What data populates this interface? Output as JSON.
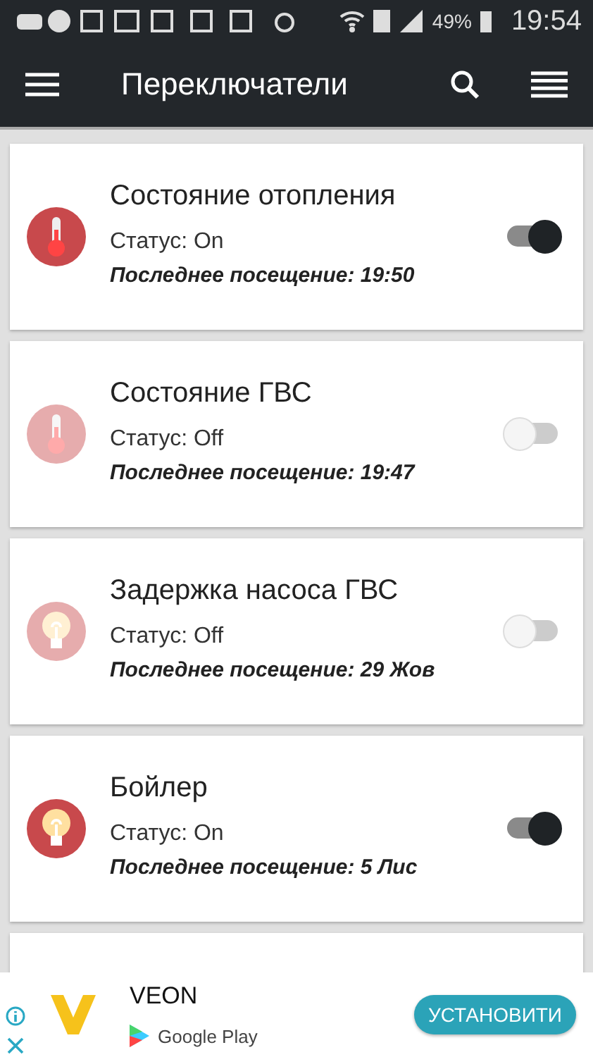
{
  "status_bar": {
    "battery": "49%",
    "time": "19:54"
  },
  "toolbar": {
    "title": "Переключатели"
  },
  "switches": [
    {
      "kind": "thermometer",
      "name": "Состояние отопления",
      "status": "Статус: On",
      "last_visit": "Последнее посещение: 19:50",
      "on": true
    },
    {
      "kind": "thermometer",
      "name": "Состояние ГВС",
      "status": "Статус: Off",
      "last_visit": "Последнее посещение: 19:47",
      "on": false
    },
    {
      "kind": "bulb",
      "name": "Задержка насоса ГВС",
      "status": "Статус: Off",
      "last_visit": "Последнее посещение: 29 Жов",
      "on": false
    },
    {
      "kind": "bulb",
      "name": "Бойлер",
      "status": "Статус: On",
      "last_visit": "Последнее посещение: 5 Лис",
      "on": true
    }
  ],
  "ad": {
    "advertiser": "VEON",
    "store": "Google Play",
    "button": "УСТАНОВИТИ"
  }
}
